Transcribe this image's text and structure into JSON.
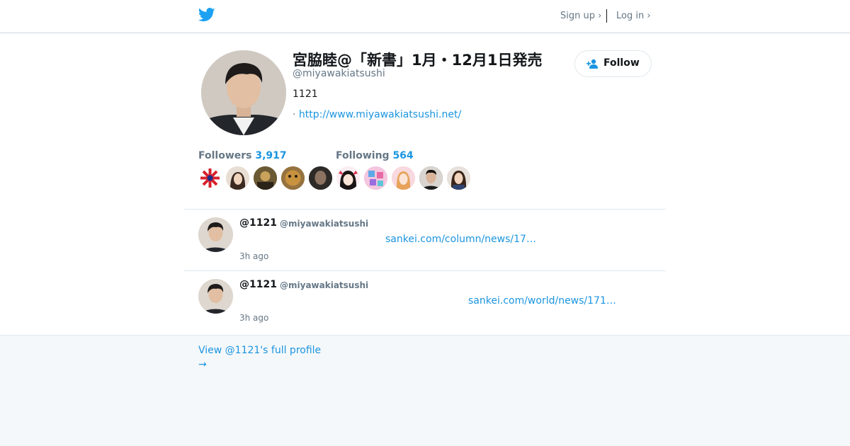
{
  "nav": {
    "signup_label": "Sign up ›",
    "login_label": "Log in ›"
  },
  "profile": {
    "display_name": "宮脇睦@「新書」1月・12月1日発売",
    "screen_name": "@miyawakiatsushi",
    "bio": "1121",
    "website_prefix": "· ",
    "website": "http://www.miyawakiatsushi.net/",
    "follow_label": "Follow"
  },
  "stats": {
    "followers_label": "Followers",
    "followers_count": "3,917",
    "following_label": "Following",
    "following_count": "564"
  },
  "tweets": [
    {
      "name": "@1121",
      "handle": "@miyawakiatsushi",
      "link": "sankei.com/column/news/17…",
      "time": "3h ago"
    },
    {
      "name": "@1121",
      "handle": "@miyawakiatsushi",
      "link": "sankei.com/world/news/171…",
      "time": "3h ago"
    }
  ],
  "footer": {
    "full_profile_label": "View @1121's full profile",
    "arrow": "→"
  },
  "colors": {
    "accent": "#1b95e0",
    "twitter_blue": "#1da1f2",
    "muted": "#657786",
    "background": "#f5f8fa"
  },
  "icons": {
    "logo": "twitter-bird-icon",
    "follow": "add-user-icon"
  }
}
